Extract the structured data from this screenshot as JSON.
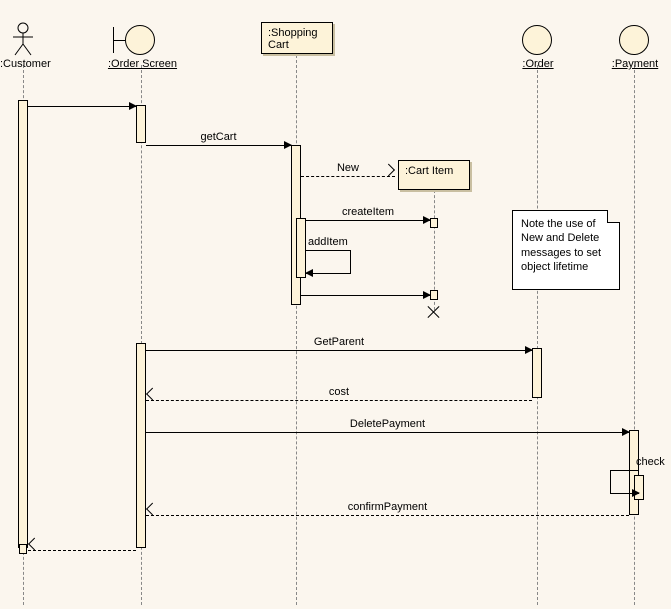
{
  "lifelines": {
    "customer": ":Customer",
    "orderScreen": ":Order Screen",
    "shoppingCart": ":Shopping Cart",
    "cartItem": ":Cart Item",
    "order": ":Order",
    "payment": ":Payment"
  },
  "messages": {
    "getCart": "getCart",
    "new": "New",
    "createItem": "createItem",
    "addItem": "addItem",
    "getParent": "GetParent",
    "cost": "cost",
    "deletePayment": "DeletePayment",
    "check": "check",
    "confirmPayment": "confirmPayment"
  },
  "note": "Note the use of New and Delete messages to set object lifetime"
}
